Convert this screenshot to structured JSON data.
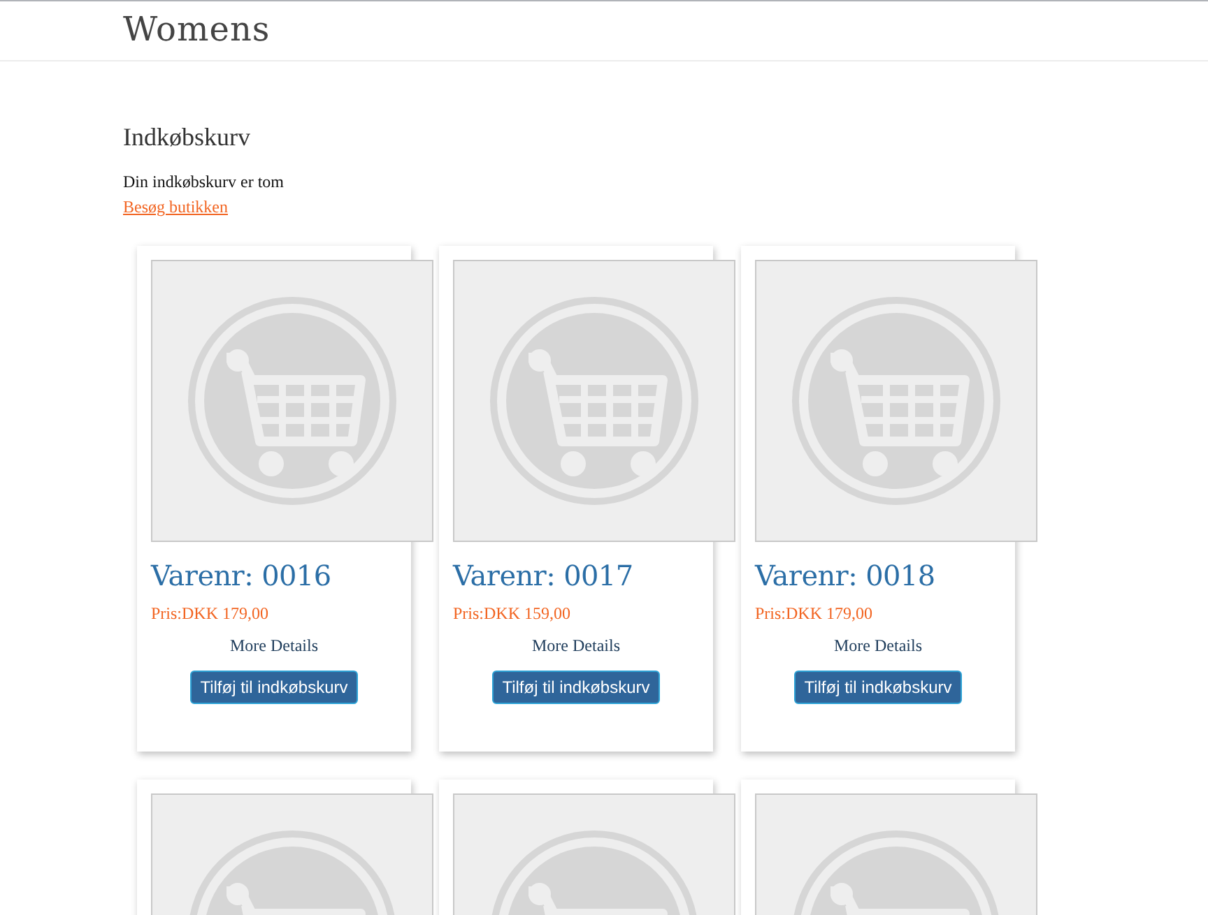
{
  "header": {
    "title": "Womens"
  },
  "cart": {
    "heading": "Indkøbskurv",
    "message": "Din indkøbskurv er tom",
    "link": "Besøg butikken"
  },
  "products": [
    {
      "kind": "full",
      "name": "Varenr: 0016",
      "price": "Pris:DKK 179,00",
      "details": "More Details",
      "button": "Tilføj til indkøbskurv"
    },
    {
      "kind": "full",
      "name": "Varenr: 0017",
      "price": "Pris:DKK 159,00",
      "details": "More Details",
      "button": "Tilføj til indkøbskurv"
    },
    {
      "kind": "full",
      "name": "Varenr: 0018",
      "price": "Pris:DKK 179,00",
      "details": "More Details",
      "button": "Tilføj til indkøbskurv"
    },
    {
      "kind": "image_only"
    },
    {
      "kind": "image_only"
    },
    {
      "kind": "image_only"
    }
  ]
}
